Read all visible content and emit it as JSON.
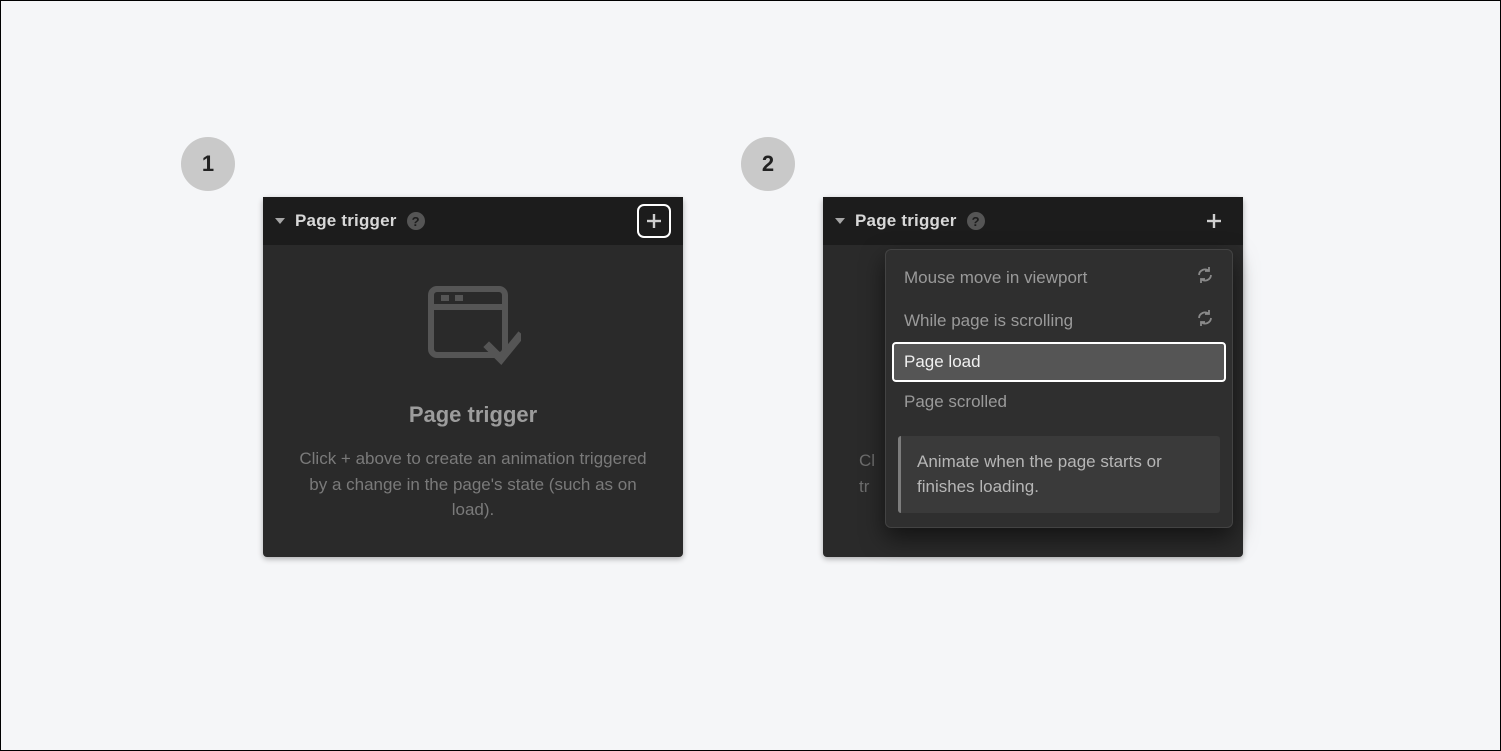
{
  "badges": {
    "one": "1",
    "two": "2"
  },
  "panel1": {
    "title": "Page trigger",
    "help": "?",
    "empty_title": "Page trigger",
    "empty_desc": "Click + above to create an animation triggered by a change in the page's state (such as on load)."
  },
  "panel2": {
    "title": "Page trigger",
    "help": "?",
    "bg_hint_line1": "Cl",
    "bg_hint_line2": "tr",
    "dropdown": {
      "items": [
        {
          "label": "Mouse move in viewport",
          "loop": true
        },
        {
          "label": "While page is scrolling",
          "loop": true
        },
        {
          "label": "Page load",
          "selected": true
        },
        {
          "label": "Page scrolled"
        }
      ],
      "tip": "Animate when the page starts or finishes loading."
    }
  }
}
